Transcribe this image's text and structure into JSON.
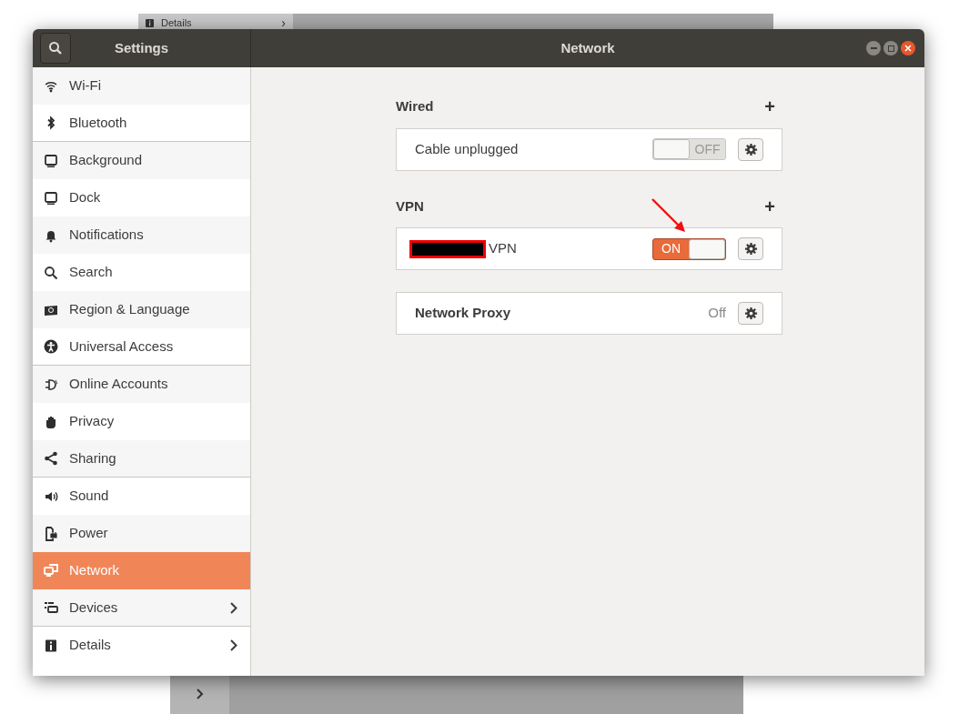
{
  "background_window": {
    "sidebar_item": "Details",
    "chevron": "›"
  },
  "window": {
    "sidebar_title": "Settings",
    "title": "Network"
  },
  "sidebar": {
    "items": [
      {
        "label": "Wi-Fi",
        "selected": false,
        "chevron": false,
        "divider_after": false
      },
      {
        "label": "Bluetooth",
        "selected": false,
        "chevron": false,
        "divider_after": true
      },
      {
        "label": "Background",
        "selected": false,
        "chevron": false,
        "divider_after": false
      },
      {
        "label": "Dock",
        "selected": false,
        "chevron": false,
        "divider_after": false
      },
      {
        "label": "Notifications",
        "selected": false,
        "chevron": false,
        "divider_after": false
      },
      {
        "label": "Search",
        "selected": false,
        "chevron": false,
        "divider_after": false
      },
      {
        "label": "Region & Language",
        "selected": false,
        "chevron": false,
        "divider_after": false
      },
      {
        "label": "Universal Access",
        "selected": false,
        "chevron": false,
        "divider_after": true
      },
      {
        "label": "Online Accounts",
        "selected": false,
        "chevron": false,
        "divider_after": false
      },
      {
        "label": "Privacy",
        "selected": false,
        "chevron": false,
        "divider_after": false
      },
      {
        "label": "Sharing",
        "selected": false,
        "chevron": false,
        "divider_after": true
      },
      {
        "label": "Sound",
        "selected": false,
        "chevron": false,
        "divider_after": false
      },
      {
        "label": "Power",
        "selected": false,
        "chevron": false,
        "divider_after": false
      },
      {
        "label": "Network",
        "selected": true,
        "chevron": false,
        "divider_after": false
      },
      {
        "label": "Devices",
        "selected": false,
        "chevron": true,
        "divider_after": true
      },
      {
        "label": "Details",
        "selected": false,
        "chevron": true,
        "divider_after": false
      }
    ]
  },
  "sections": [
    {
      "title": "Wired",
      "add": "+",
      "rows": [
        {
          "kind": "switch",
          "name": "Cable unplugged",
          "redacted": false,
          "on": false,
          "switch_label": "OFF"
        }
      ]
    },
    {
      "title": "VPN",
      "add": "+",
      "rows": [
        {
          "kind": "switch",
          "name": "VPN",
          "redacted": true,
          "on": true,
          "switch_label": "ON"
        }
      ]
    },
    {
      "rows": [
        {
          "kind": "status",
          "name": "Network Proxy",
          "status": "Off"
        }
      ]
    }
  ]
}
